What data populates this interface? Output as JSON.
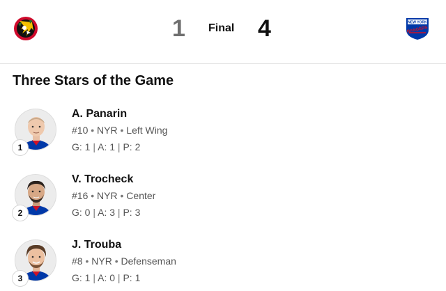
{
  "scoreboard": {
    "home_team_logo": "chicago-blackhawks-logo",
    "away_team_logo": "new-york-rangers-logo",
    "home_score": "1",
    "status": "Final",
    "away_score": "4",
    "away_logo_text": [
      "NEW YORK",
      "RANGERS"
    ]
  },
  "section_title": "Three Stars of the Game",
  "stars": [
    {
      "rank": "1",
      "name": "A. Panarin",
      "number": "#10",
      "team": "NYR",
      "position": "Left Wing",
      "goals": "G: 1",
      "assists": "A: 1",
      "points": "P: 2"
    },
    {
      "rank": "2",
      "name": "V. Trocheck",
      "number": "#16",
      "team": "NYR",
      "position": "Center",
      "goals": "G: 0",
      "assists": "A: 3",
      "points": "P: 3"
    },
    {
      "rank": "3",
      "name": "J. Trouba",
      "number": "#8",
      "team": "NYR",
      "position": "Defenseman",
      "goals": "G: 1",
      "assists": "A: 0",
      "points": "P: 1"
    }
  ],
  "separators": {
    "dot": "•",
    "bar": "|"
  },
  "colors": {
    "rangers_blue": "#0038a8",
    "rangers_red": "#ce1126",
    "blackhawks_red": "#cf0a2c",
    "text_secondary": "#555555",
    "score_losing": "#6f6f6f"
  }
}
